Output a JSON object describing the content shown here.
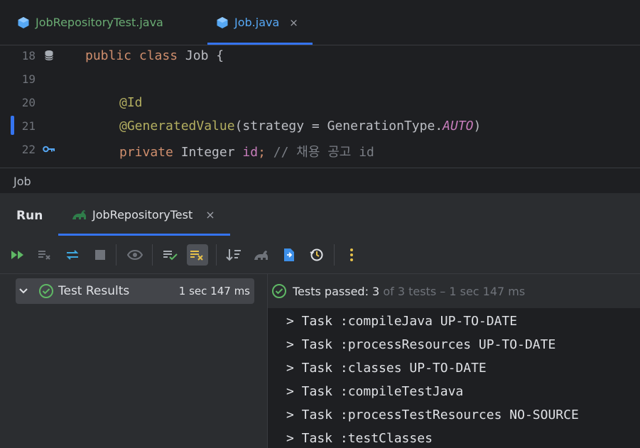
{
  "editor_tabs": [
    {
      "label": "JobRepositoryTest.java"
    },
    {
      "label": "Job.java",
      "close": "×"
    }
  ],
  "editor": {
    "lines": [
      {
        "num": "18"
      },
      {
        "num": "19"
      },
      {
        "num": "20"
      },
      {
        "num": "21"
      },
      {
        "num": "22"
      }
    ],
    "code": {
      "l18": {
        "kw1": "public",
        "kw2": "class",
        "name": "Job",
        "brace": "{"
      },
      "l20": {
        "ann": "@Id"
      },
      "l21": {
        "ann": "@GeneratedValue",
        "open": "(strategy = GenerationType.",
        "const": "AUTO",
        "close": ")"
      },
      "l22": {
        "kw": "private",
        "type": "Integer",
        "field": "id",
        "semi": ";",
        "comment": "// 채용 공고 id"
      }
    }
  },
  "breadcrumb": {
    "label": "Job"
  },
  "run_panel": {
    "title": "Run",
    "tab_label": "JobRepositoryTest",
    "tab_close": "×"
  },
  "tree": {
    "root_label": "Test Results",
    "root_time": "1 sec 147 ms"
  },
  "status": {
    "passed_label": "Tests passed:",
    "passed_count": "3",
    "rest": "of 3 tests – 1 sec 147 ms"
  },
  "console": {
    "lines": [
      "> Task :compileJava UP-TO-DATE",
      "> Task :processResources UP-TO-DATE",
      "> Task :classes UP-TO-DATE",
      "> Task :compileTestJava",
      "> Task :processTestResources NO-SOURCE",
      "> Task :testClasses"
    ]
  },
  "colors": {
    "accent": "#3574f0",
    "success": "#5fb865",
    "java_icon": "#56a8f5"
  }
}
